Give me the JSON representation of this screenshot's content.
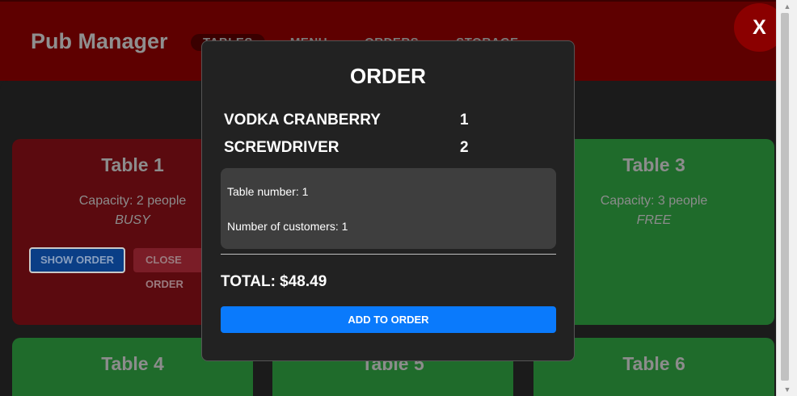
{
  "app": {
    "brand": "Pub Manager"
  },
  "nav": {
    "items": [
      {
        "label": "TABLES",
        "active": true
      },
      {
        "label": "MENU",
        "active": false
      },
      {
        "label": "ORDERS",
        "active": false
      },
      {
        "label": "STORAGE",
        "active": false
      }
    ]
  },
  "tables": [
    {
      "title": "Table 1",
      "capacity": "Capacity: 2 people",
      "status": "BUSY",
      "show_label": "SHOW ORDER",
      "close_label": "CLOSE ORDER"
    },
    {
      "title": "Table 3",
      "capacity": "Capacity: 3 people",
      "status": "FREE"
    },
    {
      "title": "Table 4"
    },
    {
      "title": "Table 5"
    },
    {
      "title": "Table 6"
    }
  ],
  "modal": {
    "close_label": "X",
    "title": "ORDER",
    "items": [
      {
        "name": "VODKA CRANBERRY",
        "qty": "1"
      },
      {
        "name": "SCREWDRIVER",
        "qty": "2"
      }
    ],
    "info": {
      "table_number": "Table number: 1",
      "customers": "Number of customers: 1"
    },
    "total": "TOTAL: $48.49",
    "add_label": "ADD TO ORDER"
  },
  "colors": {
    "header": "#5e0000",
    "busy": "#5b0a0f",
    "free": "#1f6b2b",
    "accent": "#0a7afc",
    "close_fab": "#8b0000"
  },
  "icons": {
    "scroll_up": "triangle-up-icon",
    "scroll_down": "triangle-down-icon"
  }
}
